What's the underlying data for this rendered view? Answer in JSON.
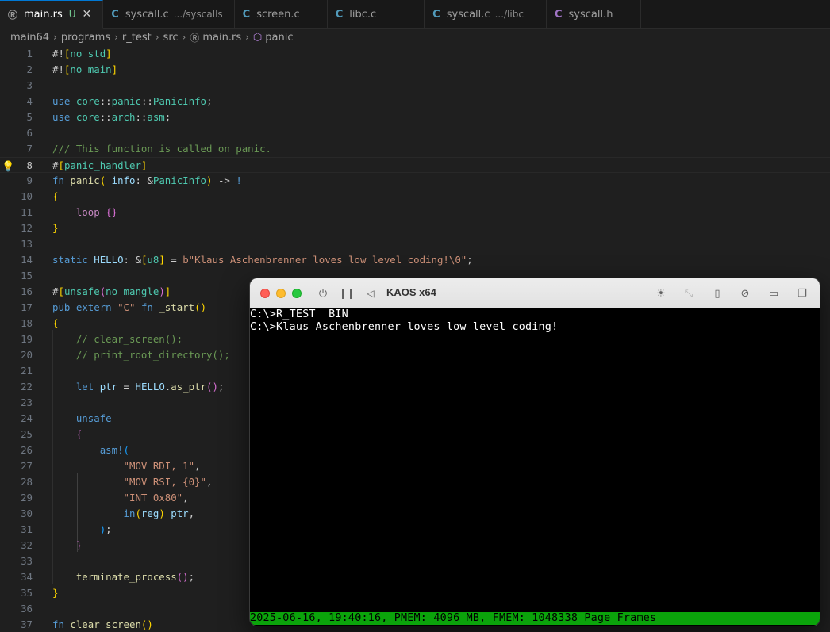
{
  "tabs": [
    {
      "icon": "Ⓡ",
      "label": "main.rs",
      "desc": "",
      "modified": "U",
      "close": "✕"
    },
    {
      "icon": "C",
      "label": "syscall.c",
      "desc": ".../syscalls"
    },
    {
      "icon": "C",
      "label": "screen.c",
      "desc": ""
    },
    {
      "icon": "C",
      "label": "libc.c",
      "desc": ""
    },
    {
      "icon": "C",
      "label": "syscall.c",
      "desc": ".../libc"
    },
    {
      "icon": "C",
      "label": "syscall.h",
      "desc": ""
    }
  ],
  "breadcrumb": {
    "items": [
      "main64",
      "programs",
      "r_test",
      "src",
      "main.rs",
      "panic"
    ],
    "separator": "›"
  },
  "editor": {
    "line_numbers": [
      "1",
      "2",
      "3",
      "4",
      "5",
      "6",
      "7",
      "8",
      "9",
      "10",
      "11",
      "12",
      "13",
      "14",
      "15",
      "16",
      "17",
      "18",
      "19",
      "20",
      "21",
      "22",
      "23",
      "24",
      "25",
      "26",
      "27",
      "28",
      "29",
      "30",
      "31",
      "32",
      "33",
      "34",
      "35",
      "36",
      "37"
    ],
    "current_line": "8",
    "lightbulb_icon": "lightbulb-icon"
  },
  "emulator": {
    "title": "KAOS x64",
    "icons": [
      "power-icon",
      "pause-icon",
      "back-icon",
      "brightness-icon",
      "resize-icon",
      "usb-icon",
      "network-icon",
      "folder-share-icon",
      "windows-icon"
    ],
    "terminal_lines": [
      "C:\\>R_TEST  BIN",
      "C:\\>Klaus Aschenbrenner loves low level coding!"
    ],
    "status_line": "2025-06-16, 19:40:16, PMEM: 4096 MB, FMEM: 1048338 Page Frames",
    "status_color": "#0ba30b"
  }
}
